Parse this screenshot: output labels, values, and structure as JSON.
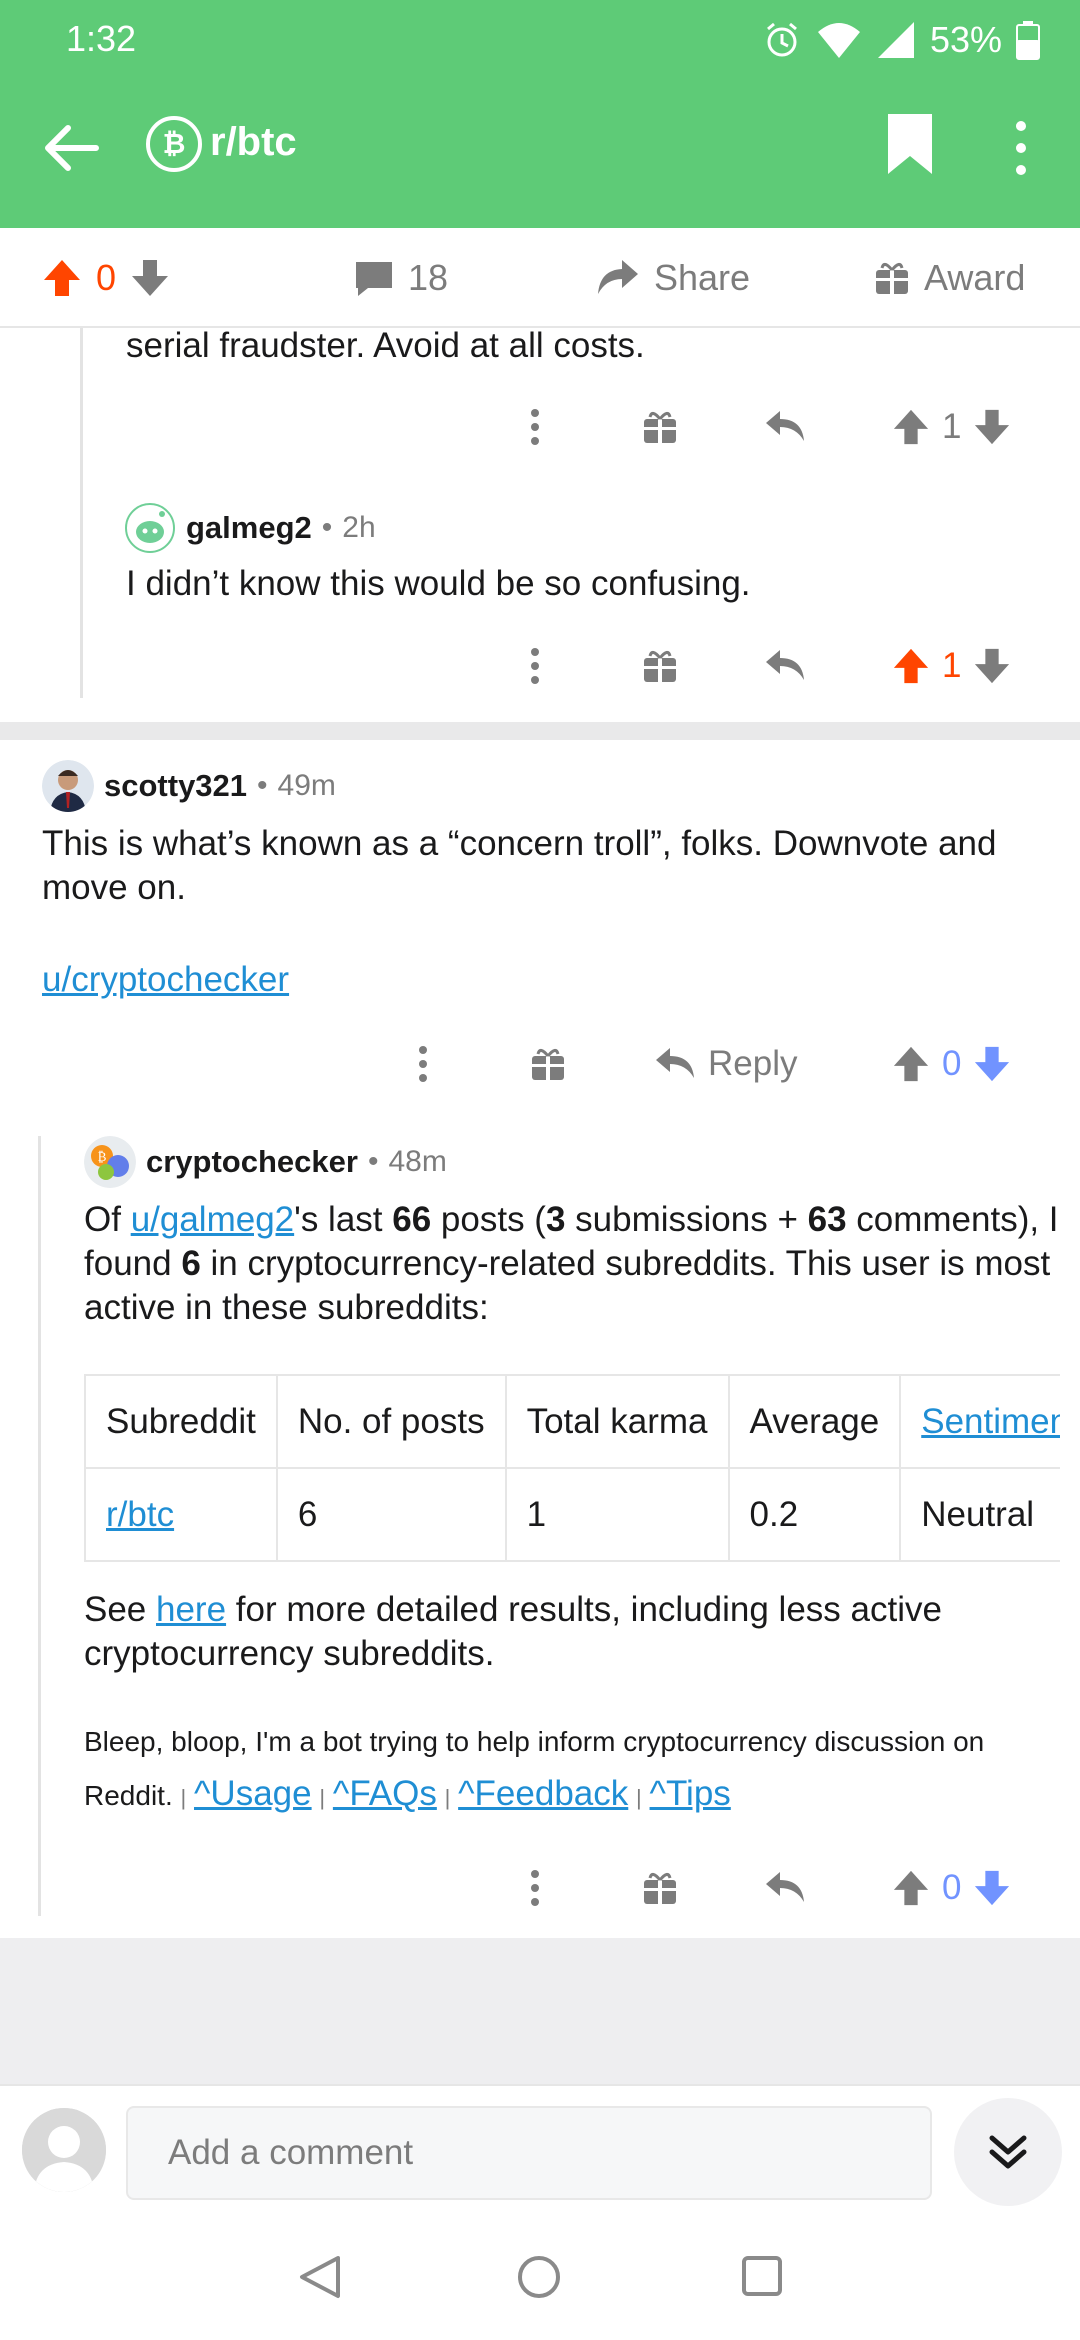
{
  "status_bar": {
    "time": "1:32",
    "battery": "53%"
  },
  "app_bar": {
    "subreddit": "r/btc"
  },
  "post_actions": {
    "score": "0",
    "comments": "18",
    "share": "Share",
    "award": "Award"
  },
  "comments": [
    {
      "body": "serial fraudster.  Avoid at all costs.",
      "score": "1"
    },
    {
      "user": "galmeg2",
      "age": "2h",
      "body": "I didn’t know this would be so confusing.",
      "score": "1"
    },
    {
      "user": "scotty321",
      "age": "49m",
      "body_line1": "This is what’s known as a “concern troll”, folks. Downvote and",
      "body_line2": "move on.",
      "link": "u/cryptochecker",
      "reply": "Reply",
      "score": "0"
    },
    {
      "user": "cryptochecker",
      "age": "48m",
      "intro": {
        "of": "Of ",
        "user_link": "u/galmeg2",
        "last": "'s last ",
        "posts_n": "66",
        "posts": " posts (",
        "subs_n": "3",
        "subs": " submissions + ",
        "comments_n": "63",
        "comments_found": " comments), I found ",
        "found_n": "6",
        "rest": " in cryptocurrency-related subreddits. This user is most active in these subreddits:"
      },
      "table": {
        "headers": [
          "Subreddit",
          "No. of posts",
          "Total karma",
          "Average",
          "Sentiment"
        ],
        "rows": [
          [
            "r/btc",
            "6",
            "1",
            "0.2",
            "Neutral"
          ]
        ]
      },
      "see_here": {
        "see": "See ",
        "here": "here",
        "rest": " for more detailed results, including less active cryptocurrency subreddits."
      },
      "bot_footer": {
        "text": "Bleep, bloop, I'm a bot trying to help inform cryptocurrency discussion on Reddit.",
        "sep": "|",
        "links": [
          "^Usage",
          "^FAQs",
          "^Feedback",
          "^Tips"
        ]
      },
      "score": "0"
    }
  ],
  "composer": {
    "placeholder": "Add a comment"
  },
  "colors": {
    "brand": "#5ecb77",
    "upvote": "#ff4500",
    "downvote": "#7193ff",
    "link": "#1f8ed4"
  }
}
